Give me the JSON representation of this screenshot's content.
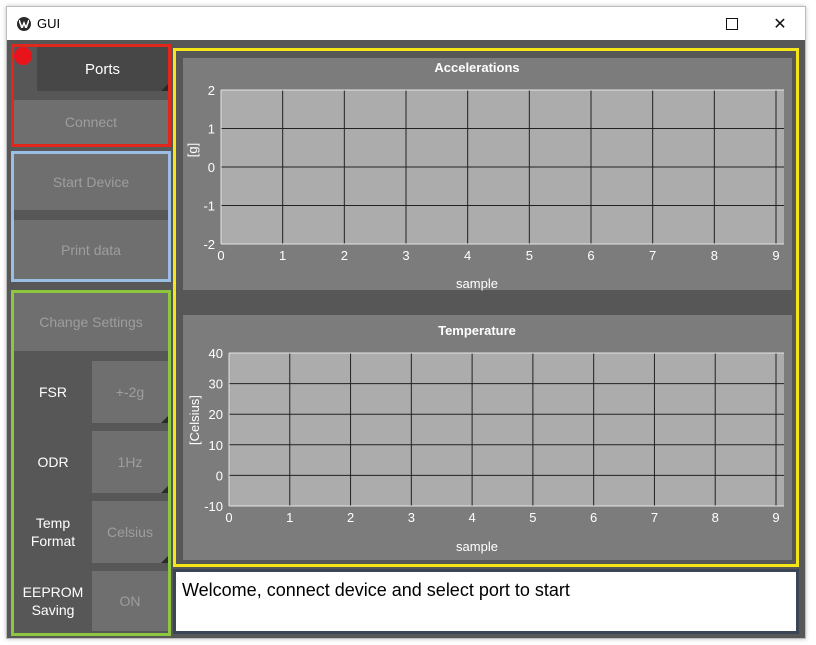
{
  "window": {
    "title": "GUI",
    "maximize_icon": "maximize-icon",
    "close_icon": "close-icon",
    "close_glyph": "✕"
  },
  "ports": {
    "label": "Ports",
    "indicator_color": "#e8131b"
  },
  "connect": {
    "label": "Connect"
  },
  "start_device": {
    "label": "Start Device"
  },
  "print_data": {
    "label": "Print data"
  },
  "settings": {
    "change_label": "Change Settings",
    "fsr_label": "FSR",
    "fsr_value": "+-2g",
    "odr_label": "ODR",
    "odr_value": "1Hz",
    "temp_format_label_1": "Temp",
    "temp_format_label_2": "Format",
    "temp_format_value": "Celsius",
    "eeprom_label_1": "EEPROM",
    "eeprom_label_2": "Saving",
    "eeprom_value": "ON"
  },
  "status": {
    "message": "Welcome, connect device and select port to start"
  },
  "frame_colors": {
    "ports": "#e1261c",
    "device": "#9bbfe4",
    "settings": "#8dc63f",
    "charts": "#f5e617",
    "status": "#3b4555"
  },
  "chart_data": [
    {
      "type": "line",
      "title": "Accelerations",
      "xlabel": "sample",
      "ylabel": "[g]",
      "xlim": [
        0,
        9
      ],
      "ylim": [
        -2,
        2
      ],
      "x_ticks": [
        "0",
        "1",
        "2",
        "3",
        "4",
        "5",
        "6",
        "7",
        "8",
        "9"
      ],
      "y_ticks": [
        "2",
        "1",
        "0",
        "-1",
        "-2"
      ],
      "grid": true,
      "series": []
    },
    {
      "type": "line",
      "title": "Temperature",
      "xlabel": "sample",
      "ylabel": "[Celsius]",
      "xlim": [
        0,
        9
      ],
      "ylim": [
        -10,
        40
      ],
      "x_ticks": [
        "0",
        "1",
        "2",
        "3",
        "4",
        "5",
        "6",
        "7",
        "8",
        "9"
      ],
      "y_ticks": [
        "40",
        "30",
        "20",
        "10",
        "0",
        "-10"
      ],
      "grid": true,
      "series": []
    }
  ]
}
